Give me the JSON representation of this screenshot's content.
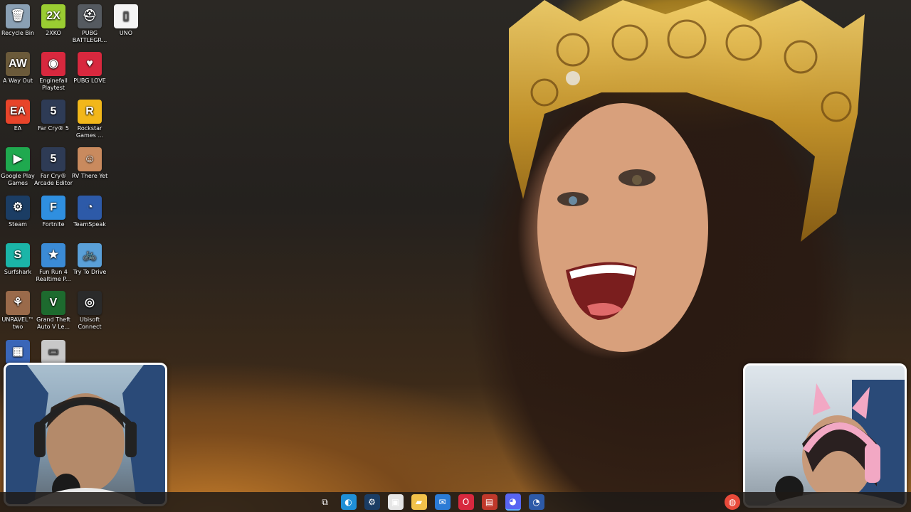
{
  "desktop": {
    "icons": [
      {
        "label": "Recycle Bin",
        "glyph": "🗑",
        "color": "#8aa0b4",
        "icon": "recycle-bin-icon"
      },
      {
        "label": "2XKO",
        "glyph": "2X",
        "color": "#9acd32",
        "icon": "2xko-icon"
      },
      {
        "label": "PUBG BATTLEGR...",
        "glyph": "⛑",
        "color": "#555a60",
        "icon": "pubg-helmet-icon"
      },
      {
        "label": "UNO",
        "glyph": "▯",
        "color": "#f4f4f4",
        "icon": "file-icon"
      },
      {
        "label": "A Way Out",
        "glyph": "AW",
        "color": "#6b5a3a",
        "icon": "a-way-out-icon"
      },
      {
        "label": "Enginefall Playtest",
        "glyph": "◉",
        "color": "#d8283e",
        "icon": "enginefall-icon"
      },
      {
        "label": "PUBG LOVE",
        "glyph": "♥",
        "color": "#d8283e",
        "icon": "pubg-love-icon"
      },
      {
        "label": "EA",
        "glyph": "EA",
        "color": "#e8442a",
        "icon": "ea-icon"
      },
      {
        "label": "Far Cry® 5",
        "glyph": "5",
        "color": "#2e3b55",
        "icon": "far-cry-5-icon"
      },
      {
        "label": "Rockstar Games ...",
        "glyph": "R",
        "color": "#f2b71a",
        "icon": "rockstar-icon"
      },
      {
        "label": "Google Play Games",
        "glyph": "▶",
        "color": "#1fa94f",
        "icon": "google-play-games-icon"
      },
      {
        "label": "Far Cry® Arcade Editor",
        "glyph": "5",
        "color": "#2e3b55",
        "icon": "far-cry-arcade-icon"
      },
      {
        "label": "RV There Yet",
        "glyph": "☺",
        "color": "#c98a5e",
        "icon": "rv-there-yet-icon"
      },
      {
        "label": "Steam",
        "glyph": "⚙",
        "color": "#1b3d64",
        "icon": "steam-icon"
      },
      {
        "label": "Fortnite",
        "glyph": "F",
        "color": "#2f8fe0",
        "icon": "fortnite-icon"
      },
      {
        "label": "TeamSpeak",
        "glyph": "◔",
        "color": "#2d5aa8",
        "icon": "teamspeak-icon"
      },
      {
        "label": "Surfshark",
        "glyph": "S",
        "color": "#1bb5a8",
        "icon": "surfshark-icon"
      },
      {
        "label": "Fun Run 4 Realtime P...",
        "glyph": "★",
        "color": "#3b8bd6",
        "icon": "fun-run-icon"
      },
      {
        "label": "Try To Drive",
        "glyph": "🚲",
        "color": "#5aa0d8",
        "icon": "try-to-drive-icon"
      },
      {
        "label": "UNRAVEL™ two",
        "glyph": "⚘",
        "color": "#9a6a4a",
        "icon": "unravel-icon"
      },
      {
        "label": "Grand Theft Auto V Le...",
        "glyph": "V",
        "color": "#1d6a2e",
        "icon": "gta-v-icon"
      },
      {
        "label": "Ubisoft Connect",
        "glyph": "◎",
        "color": "#2a2a2a",
        "icon": "ubisoft-icon"
      },
      {
        "label": "",
        "glyph": "▦",
        "color": "#3a66b8",
        "icon": "partial-icon-1"
      },
      {
        "label": "",
        "glyph": "▭",
        "color": "#c8c8c8",
        "icon": "partial-icon-2"
      }
    ]
  },
  "taskbar": {
    "items": [
      {
        "name": "taskview-icon",
        "glyph": "⧉",
        "color": "transparent"
      },
      {
        "name": "edge-icon",
        "glyph": "◐",
        "color": "#1f8fd6"
      },
      {
        "name": "steam-taskbar-icon",
        "glyph": "⚙",
        "color": "#1b3d64"
      },
      {
        "name": "store-icon",
        "glyph": "▣",
        "color": "#e6e6e6"
      },
      {
        "name": "file-explorer-icon",
        "glyph": "▰",
        "color": "#f2c14a"
      },
      {
        "name": "mail-icon",
        "glyph": "✉",
        "color": "#2b7bd6"
      },
      {
        "name": "opera-icon",
        "glyph": "O",
        "color": "#d8283e"
      },
      {
        "name": "app-banner-icon",
        "glyph": "▤",
        "color": "#c0392b"
      },
      {
        "name": "discord-icon",
        "glyph": "◕",
        "color": "#5865f2"
      },
      {
        "name": "teamspeak-taskbar-icon",
        "glyph": "◔",
        "color": "#2d5aa8"
      }
    ],
    "tray": [
      {
        "name": "chrome-icon",
        "glyph": "◍",
        "color": "#e84a3a"
      }
    ]
  }
}
